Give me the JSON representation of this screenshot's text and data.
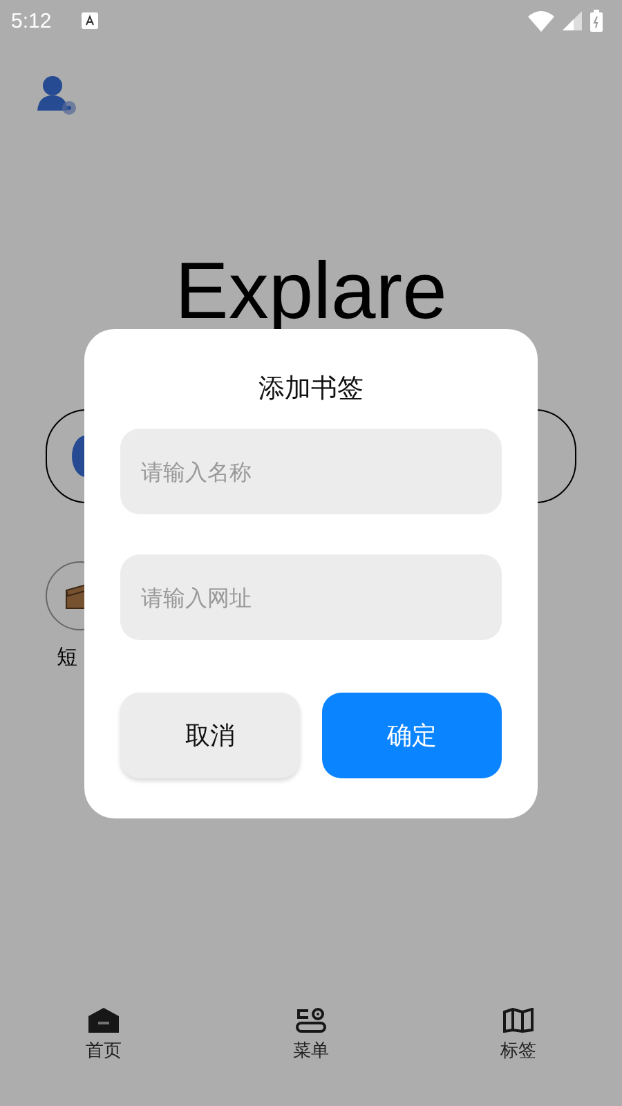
{
  "status_bar": {
    "time": "5:12"
  },
  "page": {
    "title": "Explare",
    "shortcuts": [
      {
        "label": "短"
      }
    ]
  },
  "dialog": {
    "title": "添加书签",
    "fields": [
      {
        "placeholder": "请输入名称"
      },
      {
        "placeholder": "请输入网址"
      }
    ],
    "buttons": [
      {
        "label": "取消",
        "kind": "secondary"
      },
      {
        "label": "确定",
        "kind": "primary"
      }
    ]
  },
  "bottom_nav": [
    {
      "label": "首页",
      "kind": "home"
    },
    {
      "label": "菜单",
      "kind": "menu"
    },
    {
      "label": "标签",
      "kind": "tags"
    }
  ]
}
